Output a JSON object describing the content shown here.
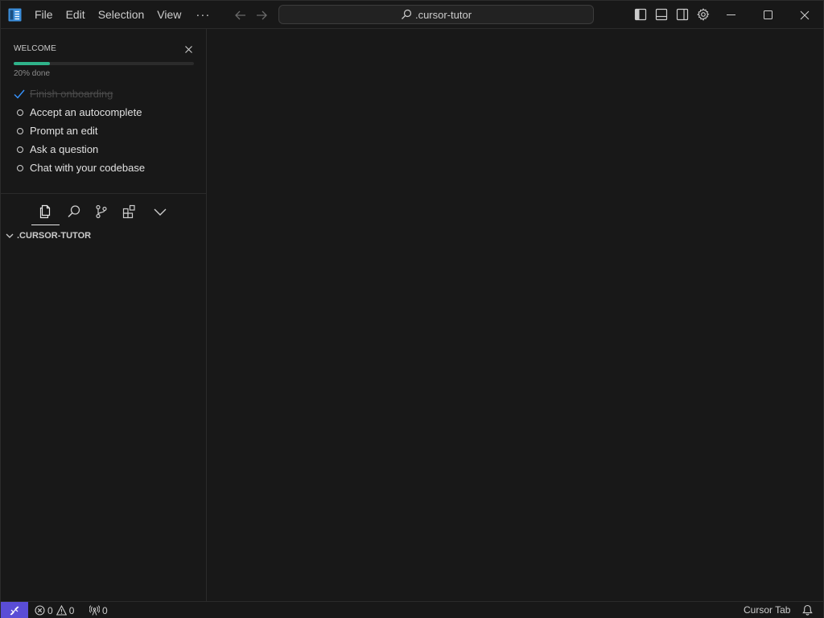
{
  "menu": {
    "file": "File",
    "edit": "Edit",
    "selection": "Selection",
    "view": "View",
    "more": "···"
  },
  "search": {
    "text": ".cursor-tutor"
  },
  "welcome": {
    "title": "WELCOME",
    "progress_percent": 20,
    "progress_label": "20% done",
    "tasks": [
      {
        "label": "Finish onboarding",
        "done": true
      },
      {
        "label": "Accept an autocomplete",
        "done": false
      },
      {
        "label": "Prompt an edit",
        "done": false
      },
      {
        "label": "Ask a question",
        "done": false
      },
      {
        "label": "Chat with your codebase",
        "done": false
      }
    ]
  },
  "explorer": {
    "title": ".CURSOR-TUTOR"
  },
  "statusbar": {
    "errors": "0",
    "warnings": "0",
    "ports": "0",
    "cursor_tab": "Cursor Tab"
  },
  "icons": {
    "app": "cursor-logo-icon",
    "back": "arrow-left-icon",
    "forward": "arrow-right-icon",
    "search": "search-icon",
    "layout_left": "toggle-primary-sidebar-icon",
    "layout_bottom": "toggle-panel-icon",
    "layout_right": "toggle-secondary-sidebar-icon",
    "settings": "gear-icon",
    "explorer": "files-icon",
    "search_view": "search-view-icon",
    "scm": "source-control-icon",
    "extensions": "extensions-icon",
    "more_views": "chevron-down-icon"
  },
  "colors": {
    "accent_progress": "#2fb38a",
    "remote_button": "#5a4dd6",
    "check": "#3794ff"
  }
}
